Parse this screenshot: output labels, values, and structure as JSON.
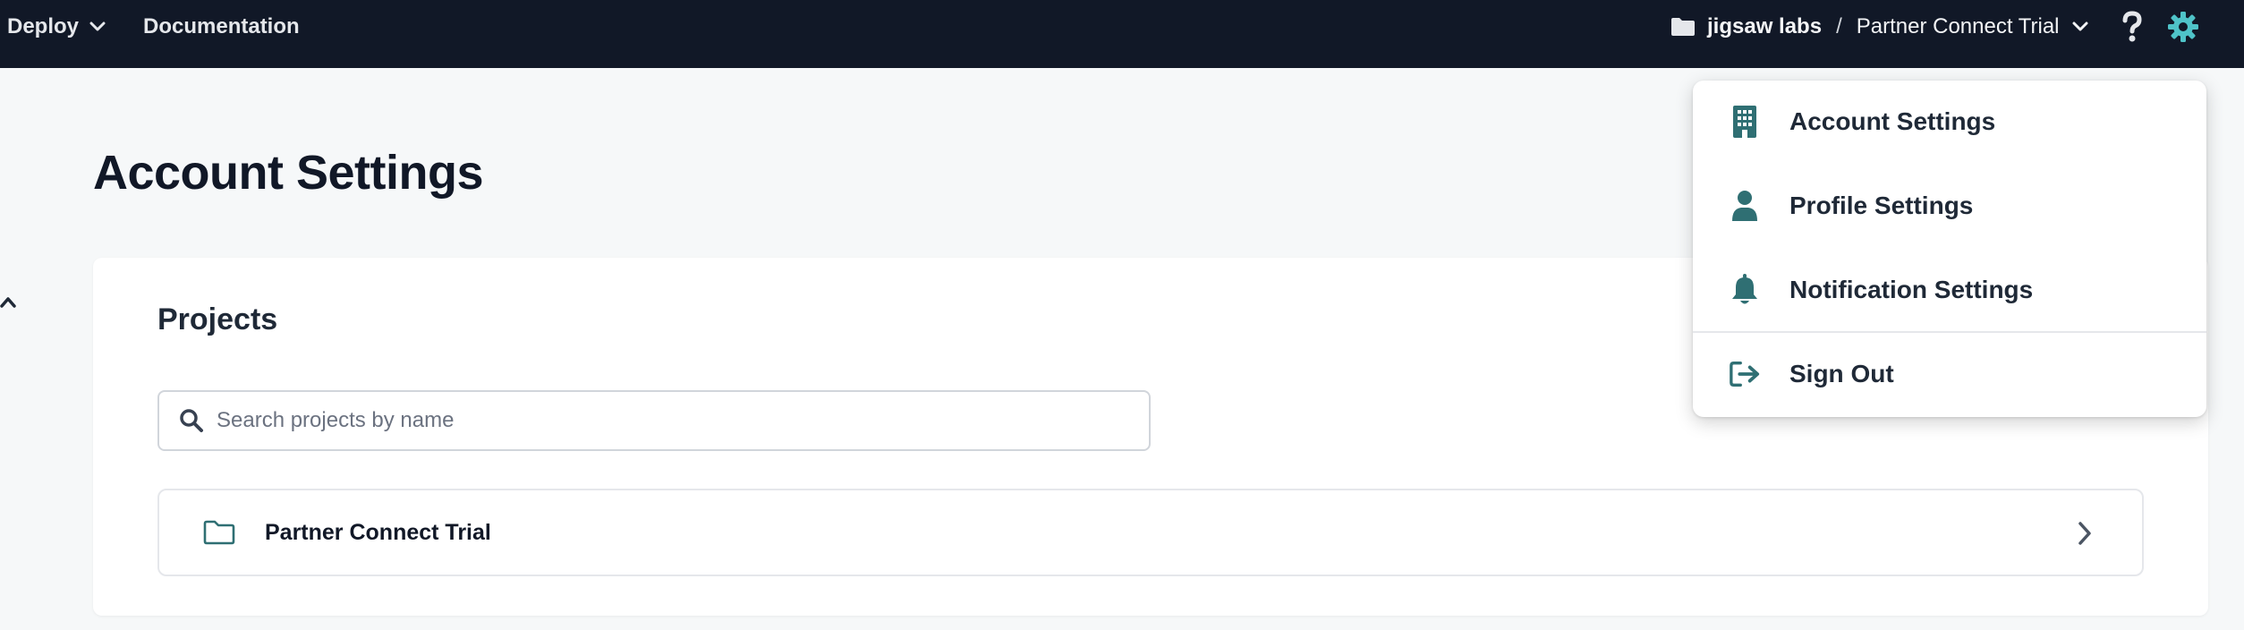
{
  "topbar": {
    "deploy_label": "Deploy",
    "docs_label": "Documentation",
    "org_name": "jigsaw labs",
    "separator": "/",
    "project_name": "Partner Connect Trial"
  },
  "page": {
    "title": "Account Settings"
  },
  "projects_card": {
    "title": "Projects",
    "search_placeholder": "Search projects by name",
    "search_value": "",
    "items": [
      {
        "name": "Partner Connect Trial"
      }
    ]
  },
  "settings_menu": {
    "items": [
      {
        "label": "Account Settings",
        "icon": "building-icon"
      },
      {
        "label": "Profile Settings",
        "icon": "user-icon"
      },
      {
        "label": "Notification Settings",
        "icon": "bell-icon"
      },
      {
        "label": "Sign Out",
        "icon": "sign-out-icon"
      }
    ]
  },
  "colors": {
    "topbar_bg": "#111827",
    "accent_teal": "#2f6f73",
    "gear_teal": "#4fc3c8",
    "page_bg": "#f6f8f9"
  }
}
